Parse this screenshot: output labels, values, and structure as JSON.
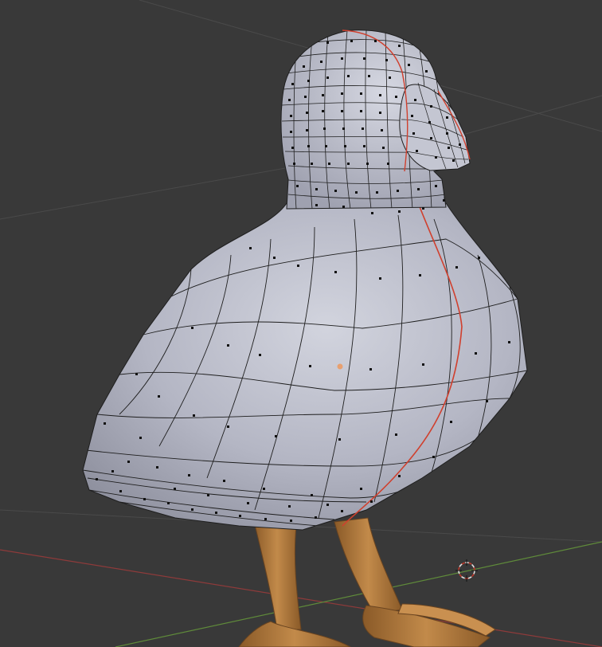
{
  "app": "Blender",
  "view": {
    "mode": "edit-mode",
    "object": "bird-mesh",
    "background_color": "#393939",
    "grid_line_color": "#4a4a4a",
    "x_axis_color": "#8e3a3a",
    "y_axis_color": "#5f8a3a",
    "mesh_color": "#b6b8c6",
    "wire_color": "#1e1e1e",
    "seam_color": "#d0402e",
    "leg_color": "#b27a3c",
    "origin_color": "#e8a070",
    "cursor_icon": "3d-cursor-icon"
  }
}
